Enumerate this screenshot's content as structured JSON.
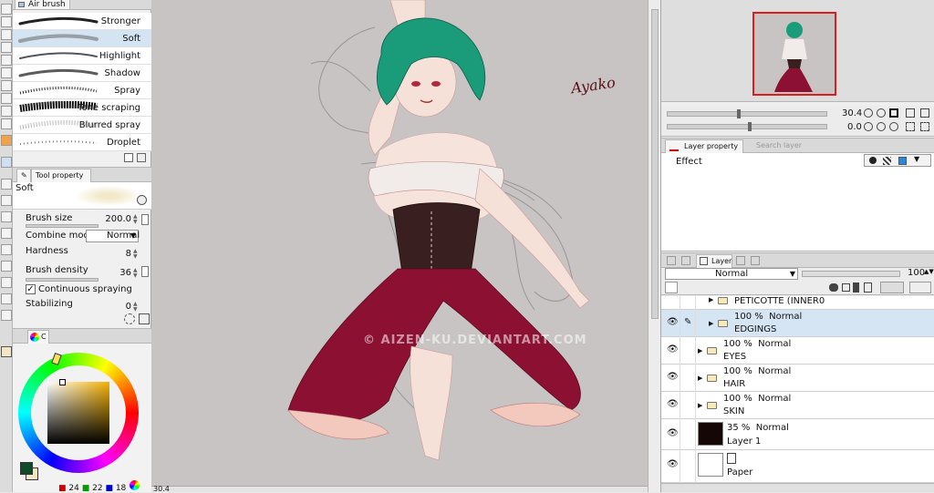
{
  "brush_tab": {
    "label": "Air brush"
  },
  "brushes": [
    {
      "label": "Stronger",
      "selected": false
    },
    {
      "label": "Soft",
      "selected": true
    },
    {
      "label": "Highlight",
      "selected": false
    },
    {
      "label": "Shadow",
      "selected": false
    },
    {
      "label": "Spray",
      "selected": false
    },
    {
      "label": "Tone scraping",
      "selected": false
    },
    {
      "label": "Blurred spray",
      "selected": false
    },
    {
      "label": "Droplet",
      "selected": false
    }
  ],
  "tool_property": {
    "tab_label": "Tool property",
    "preset_name": "Soft",
    "brush_size": {
      "label": "Brush size",
      "value": "200.0"
    },
    "combine_mode": {
      "label": "Combine mode",
      "value": "Normal"
    },
    "hardness": {
      "label": "Hardness",
      "value": "8"
    },
    "brush_density": {
      "label": "Brush density",
      "value": "36"
    },
    "continuous_spraying": {
      "label": "Continuous spraying",
      "checked": true
    },
    "stabilizing": {
      "label": "Stabilizing",
      "value": "0"
    }
  },
  "color_panel": {
    "tab_label": "C",
    "main_color": "#0f4a2a",
    "sub_color": "#f3e6c2",
    "rgb": {
      "r": "24",
      "g": "22",
      "b": "18"
    }
  },
  "canvas": {
    "watermark": "© AIZEN-KU.DEVIANTART.COM",
    "signature": "Ayako",
    "zoom": "30.4"
  },
  "navigator": {
    "zoom": "30.4",
    "rotation": "0.0"
  },
  "layer_property": {
    "tab_label": "Layer property",
    "tab2_label": "Search layer",
    "effect_label": "Effect"
  },
  "layer_panel": {
    "tab_label": "Layer",
    "blend_mode": "Normal",
    "opacity": "100",
    "layers": [
      {
        "opacity": "",
        "mode": "",
        "name": "PETICOTTE (INNER0",
        "type": "folder"
      },
      {
        "opacity": "100 %",
        "mode": "Normal",
        "name": "EDGINGS",
        "type": "folder",
        "selected": true
      },
      {
        "opacity": "100 %",
        "mode": "Normal",
        "name": "EYES",
        "type": "folder"
      },
      {
        "opacity": "100 %",
        "mode": "Normal",
        "name": "HAIR",
        "type": "folder"
      },
      {
        "opacity": "100 %",
        "mode": "Normal",
        "name": "SKIN",
        "type": "folder"
      },
      {
        "opacity": "35 %",
        "mode": "Normal",
        "name": "Layer 1",
        "type": "raster"
      },
      {
        "opacity": "",
        "mode": "",
        "name": "Paper",
        "type": "paper"
      }
    ]
  }
}
